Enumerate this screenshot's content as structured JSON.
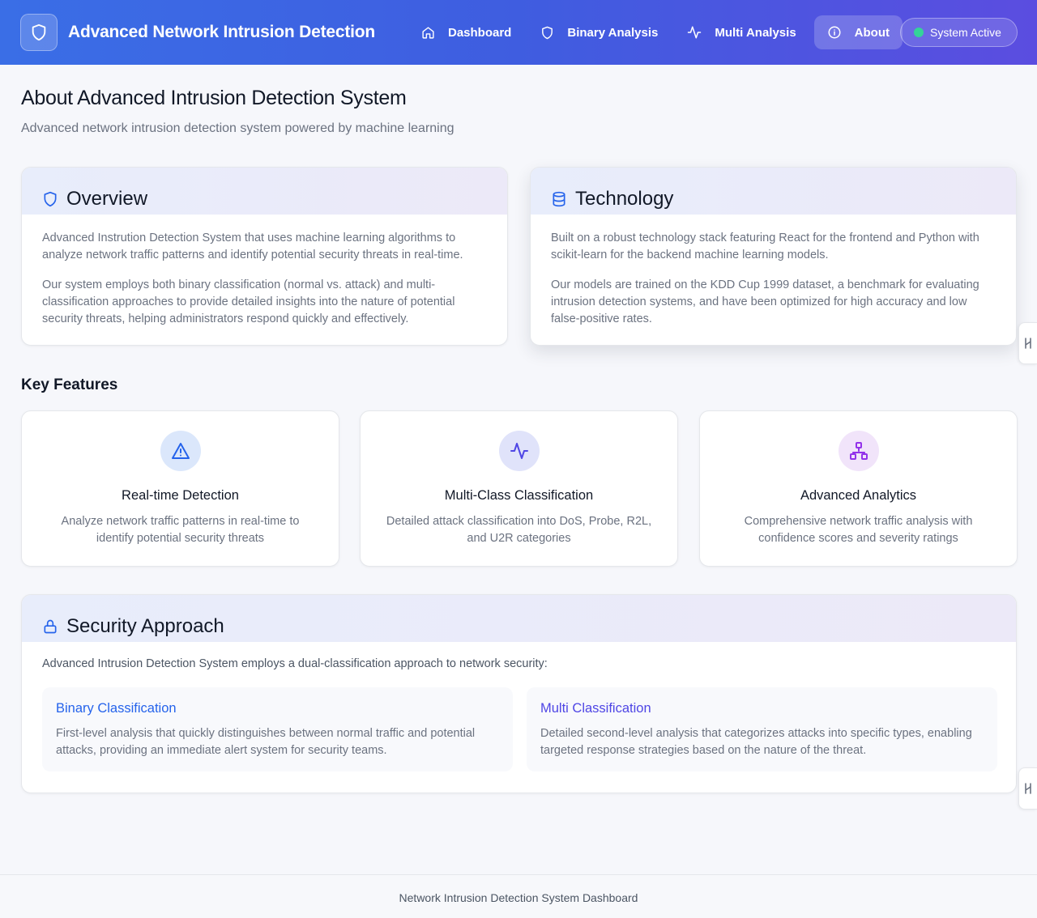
{
  "header": {
    "app_title": "Advanced Network Intrusion Detection",
    "nav": [
      {
        "label": "Dashboard",
        "icon": "home-icon"
      },
      {
        "label": "Binary Analysis",
        "icon": "shield-icon"
      },
      {
        "label": "Multi Analysis",
        "icon": "activity-icon"
      },
      {
        "label": "About",
        "icon": "info-icon",
        "active": true
      }
    ],
    "status_label": "System Active"
  },
  "page": {
    "title": "About Advanced Intrusion Detection System",
    "subtitle": "Advanced network intrusion detection system powered by machine learning"
  },
  "overview": {
    "title": "Overview",
    "icon": "shield-icon",
    "paragraphs": [
      "Advanced Instrution Detection System that uses machine learning algorithms to analyze network traffic patterns and identify potential security threats in real-time.",
      "Our system employs both binary classification (normal vs. attack) and multi-classification approaches to provide detailed insights into the nature of potential security threats, helping administrators respond quickly and effectively."
    ]
  },
  "technology": {
    "title": "Technology",
    "icon": "database-icon",
    "paragraphs": [
      "Built on a robust technology stack featuring React for the frontend and Python with scikit-learn for the backend machine learning models.",
      "Our models are trained on the KDD Cup 1999 dataset, a benchmark for evaluating intrusion detection systems, and have been optimized for high accuracy and low false-positive rates."
    ]
  },
  "key_features": {
    "title": "Key Features",
    "items": [
      {
        "title": "Real-time Detection",
        "desc": "Analyze network traffic patterns in real-time to identify potential security threats",
        "icon": "alert-triangle-icon"
      },
      {
        "title": "Multi-Class Classification",
        "desc": "Detailed attack classification into DoS, Probe, R2L, and U2R categories",
        "icon": "activity-icon"
      },
      {
        "title": "Advanced Analytics",
        "desc": "Comprehensive network traffic analysis with confidence scores and severity ratings",
        "icon": "network-icon"
      }
    ]
  },
  "security": {
    "title": "Security Approach",
    "icon": "lock-icon",
    "intro": "Advanced Intrusion Detection System employs a dual-classification approach to network security:",
    "boxes": [
      {
        "title": "Binary Classification",
        "desc": "First-level analysis that quickly distinguishes between normal traffic and potential attacks, providing an immediate alert system for security teams."
      },
      {
        "title": "Multi Classification",
        "desc": "Detailed second-level analysis that categorizes attacks into specific types, enabling targeted response strategies based on the nature of the threat."
      }
    ]
  },
  "footer": {
    "text": "Network Intrusion Detection System Dashboard"
  },
  "colors": {
    "header_start": "#3a6ee6",
    "header_end": "#5b4de0",
    "status_dot": "#34d399",
    "binary_title": "#2563eb",
    "multi_title": "#4f46e5"
  }
}
